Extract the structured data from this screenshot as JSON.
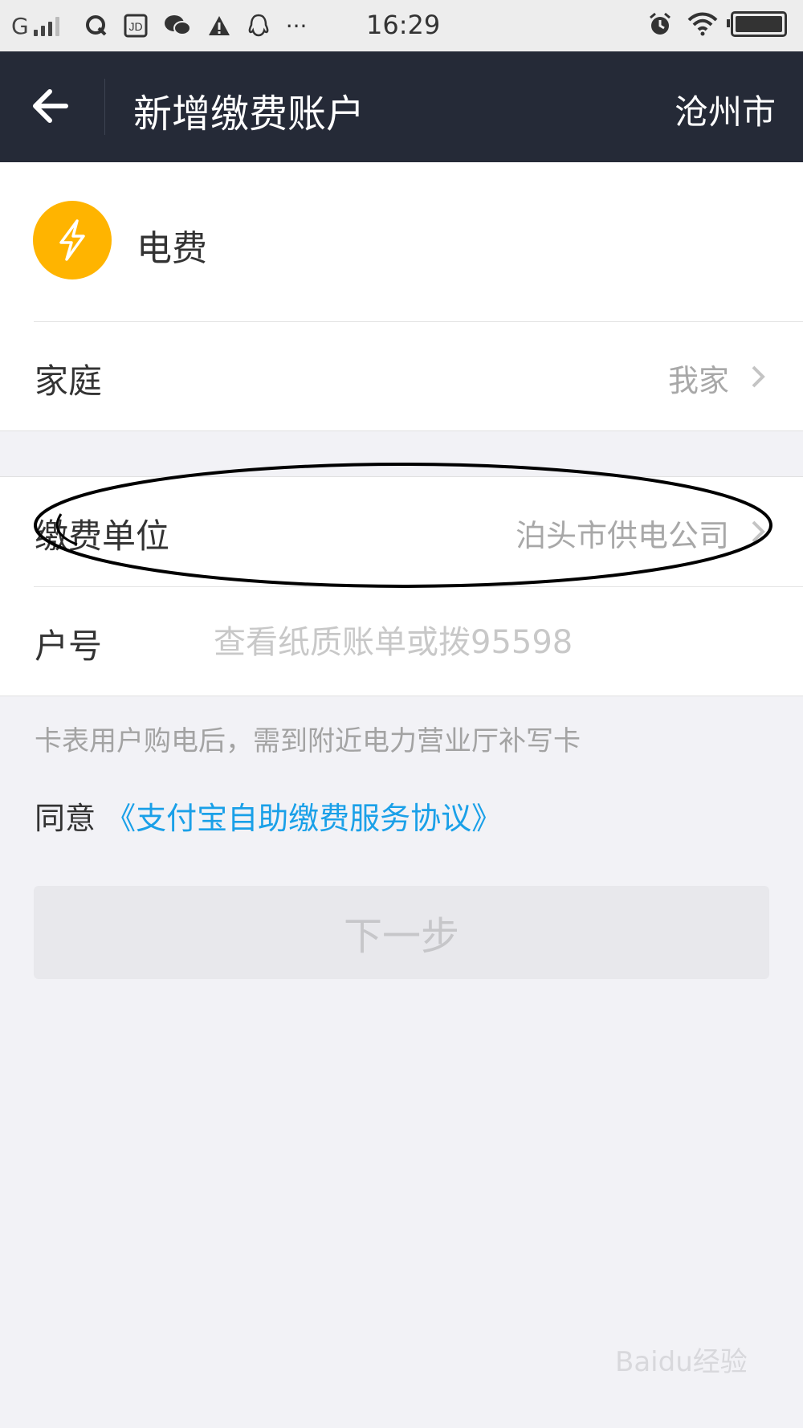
{
  "status_bar": {
    "carrier": "G",
    "signal_bars": 4,
    "icons": [
      "qq-browser-icon",
      "jd-icon",
      "wechat-icon",
      "warning-icon",
      "qq-icon",
      "more-icon"
    ],
    "more": "···",
    "time": "16:29",
    "battery_level": 1.0
  },
  "nav": {
    "title": "新增缴费账户",
    "city": "沧州市"
  },
  "service": {
    "label": "电费",
    "icon": "lightning-icon",
    "icon_color": "#ffb400"
  },
  "family": {
    "label": "家庭",
    "value": "我家"
  },
  "payee": {
    "label": "缴费单位",
    "value": "泊头市供电公司"
  },
  "account": {
    "label": "户号",
    "value": "",
    "placeholder": "查看纸质账单或拨95598"
  },
  "hint": "卡表用户购电后，需到附近电力营业厅补写卡",
  "agreement": {
    "prefix": "同意",
    "link": "《支付宝自助缴费服务协议》",
    "link_color": "#1aa0e8"
  },
  "next_button": "下一步",
  "watermark": "Baidu经验"
}
